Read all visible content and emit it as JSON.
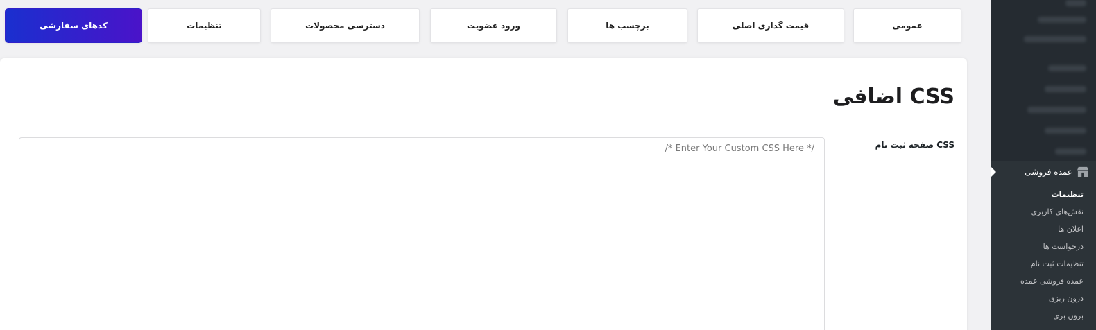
{
  "tabs": [
    {
      "label": "عمومی",
      "active": false
    },
    {
      "label": "قیمت گذاری اصلی",
      "active": false
    },
    {
      "label": "برچسب ها",
      "active": false
    },
    {
      "label": "ورود عضویت",
      "active": false
    },
    {
      "label": "دسترسی محصولات",
      "active": false
    },
    {
      "label": "تنظیمات",
      "active": false
    },
    {
      "label": "کدهای سفارشی",
      "active": true
    }
  ],
  "section": {
    "title": "CSS اضافی",
    "field_label": "CSS صفحه ثبت نام",
    "textarea_value": "",
    "textarea_placeholder": "/* Enter Your Custom CSS Here */"
  },
  "sidebar": {
    "current_menu": {
      "label": "عمده فروشی",
      "icon": "store-icon"
    },
    "submenu": [
      {
        "label": "تنظیمات",
        "current": true
      },
      {
        "label": "نقش‌های کاربری",
        "current": false
      },
      {
        "label": "اعلان ها",
        "current": false
      },
      {
        "label": "درخواست ها",
        "current": false
      },
      {
        "label": "تنظیمات ثبت نام",
        "current": false
      },
      {
        "label": "عمده فروشی عمده",
        "current": false
      },
      {
        "label": "درون ریزی",
        "current": false
      },
      {
        "label": "برون بری",
        "current": false
      }
    ]
  },
  "colors": {
    "active_tab_start": "#1a2fcf",
    "active_tab_end": "#4a13c9",
    "sidebar_bg": "#2c3338",
    "page_bg": "#f1f1f3"
  }
}
